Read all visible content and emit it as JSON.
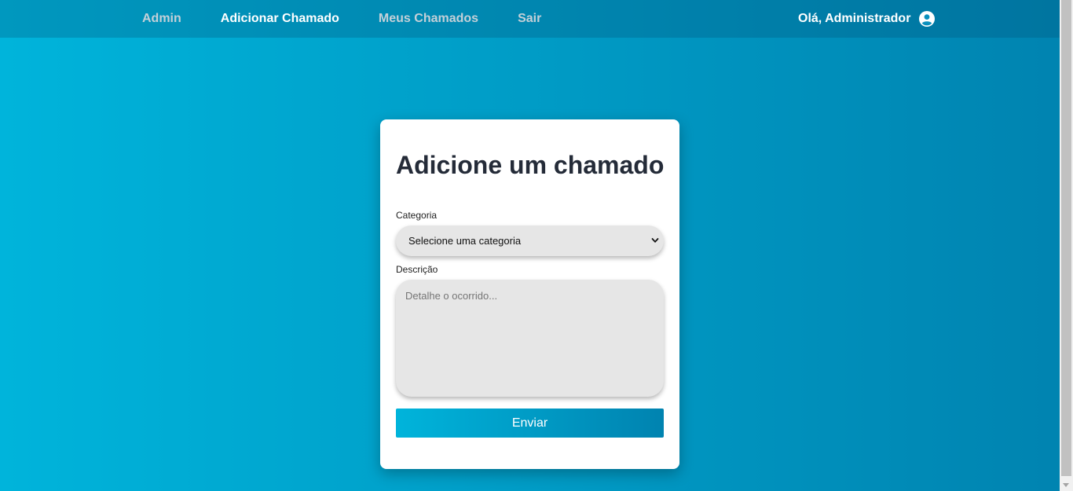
{
  "nav": {
    "links": [
      {
        "label": "Admin"
      },
      {
        "label": "Adicionar Chamado"
      },
      {
        "label": "Meus Chamados"
      },
      {
        "label": "Sair"
      }
    ],
    "greeting": "Olá, Administrador",
    "user_icon": "user-circle-icon"
  },
  "form": {
    "title": "Adicione um chamado",
    "category_label": "Categoria",
    "category_selected": "Selecione uma categoria",
    "description_label": "Descrição",
    "description_placeholder": "Detalhe o ocorrido...",
    "submit_label": "Enviar"
  },
  "colors": {
    "gradient_start": "#00b4db",
    "gradient_end": "#0083b0",
    "title": "#242b38",
    "field_bg": "#e6e6e6"
  }
}
